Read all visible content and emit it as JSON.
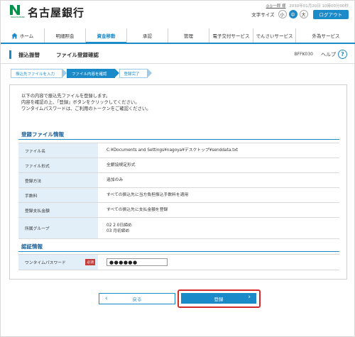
{
  "header": {
    "bank_name": "名古屋銀行",
    "logo_subtext": "NAGOYA BANK",
    "user_name": "◎◎一郎 様",
    "last_login": "2030年01月20日 10時00分00秒",
    "font_size_label": "文字サイズ",
    "font_sizes": [
      "小",
      "中",
      "大"
    ],
    "font_size_selected": "中",
    "logout_label": "ログアウト"
  },
  "nav": {
    "items": [
      {
        "label": "ホーム",
        "icon": "home-icon"
      },
      {
        "label": "明細照会"
      },
      {
        "label": "資金移動",
        "active": true
      },
      {
        "label": "承認"
      },
      {
        "label": "管理"
      },
      {
        "label": "電子交付サービス"
      },
      {
        "label": "でんさいサービス"
      },
      {
        "label": "外為サービス"
      }
    ]
  },
  "titlebar": {
    "section": "振込振替",
    "page_title": "ファイル登録確認",
    "screen_id": "BFFK030",
    "help_label": "ヘルプ",
    "help_icon": "?"
  },
  "steps": [
    {
      "label": "振込先ファイルを入力"
    },
    {
      "label": "ファイル内容を確認",
      "current": true
    },
    {
      "label": "登録完了"
    }
  ],
  "intro": {
    "line1": "以下の内容で振込先ファイルを登録します。",
    "line2": "内容を確認の上、「登録」ボタンをクリックしてください。",
    "line3": "ワンタイムパスワードは、ご利用のトークンをご確認ください。"
  },
  "file_info": {
    "title": "登録ファイル情報",
    "rows": [
      {
        "key": "ファイル名",
        "value": "C:¥Documents and Settings¥nagoya¥デスクトップ¥senddata.txt"
      },
      {
        "key": "ファイル形式",
        "value": "全銀協規定形式"
      },
      {
        "key": "登録方法",
        "value": "追加のみ"
      },
      {
        "key": "手数料",
        "value": "すべての振込先に当方負担振込手数料を適用"
      },
      {
        "key": "登録支払金額",
        "value": "すべての振込先に支払金額を登録"
      },
      {
        "key": "所属グループ",
        "value": "02 2 0日締め",
        "value2": "03 月初締め"
      }
    ]
  },
  "auth": {
    "title": "認証情報",
    "password_label": "ワンタイムパスワード",
    "required_badge": "必須",
    "password_value": "●●●●●●"
  },
  "buttons": {
    "back_label": "戻る",
    "register_label": "登録"
  },
  "colors": {
    "accent": "#1b8ac9",
    "highlight_border": "#d42a2a",
    "required_badge": "#c43c3c",
    "table_key_bg": "#e3eff8"
  }
}
